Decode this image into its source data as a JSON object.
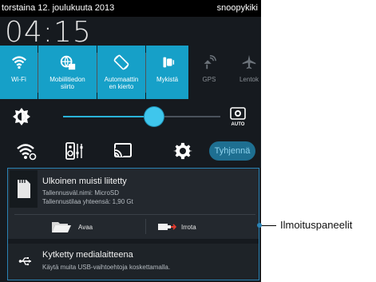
{
  "status_bar": {
    "date": "torstaina 12. joulukuuta 2013",
    "user": "snoopykiki"
  },
  "clock": "04:15",
  "quick_settings": [
    {
      "label": "Wi-Fi",
      "icon": "wifi-icon",
      "state": "on"
    },
    {
      "label": "Mobiilitiedon\nsiirto",
      "icon": "mobile-data-icon",
      "state": "on"
    },
    {
      "label": "Automaattin\nen kierto",
      "icon": "auto-rotate-icon",
      "state": "on"
    },
    {
      "label": "Mykistä",
      "icon": "mute-icon",
      "state": "on"
    },
    {
      "label": "GPS",
      "icon": "gps-icon",
      "state": "off"
    },
    {
      "label": "Lentok",
      "icon": "airplane-icon",
      "state": "off"
    }
  ],
  "brightness": {
    "level": 0.58,
    "auto_label": "AUTO"
  },
  "actions": {
    "clear_label": "Tyhjennä"
  },
  "notifications": {
    "storage": {
      "title": "Ulkoinen muisti liitetty",
      "line1": "Tallennusväl.nimi: MicroSD",
      "line2": "Tallennustilaa yhteensä: 1,90 Gt",
      "open_label": "Avaa",
      "eject_label": "Irrota"
    },
    "usb": {
      "title": "Kytketty medialaitteena",
      "subtitle": "Käytä muita USB-vaihtoehtoja koskettamalla."
    }
  },
  "callout": "Ilmoituspaneelit",
  "colors": {
    "accent": "#16a0c8",
    "panel_bg": "#161a1f",
    "callout_border": "#2a83b5"
  }
}
